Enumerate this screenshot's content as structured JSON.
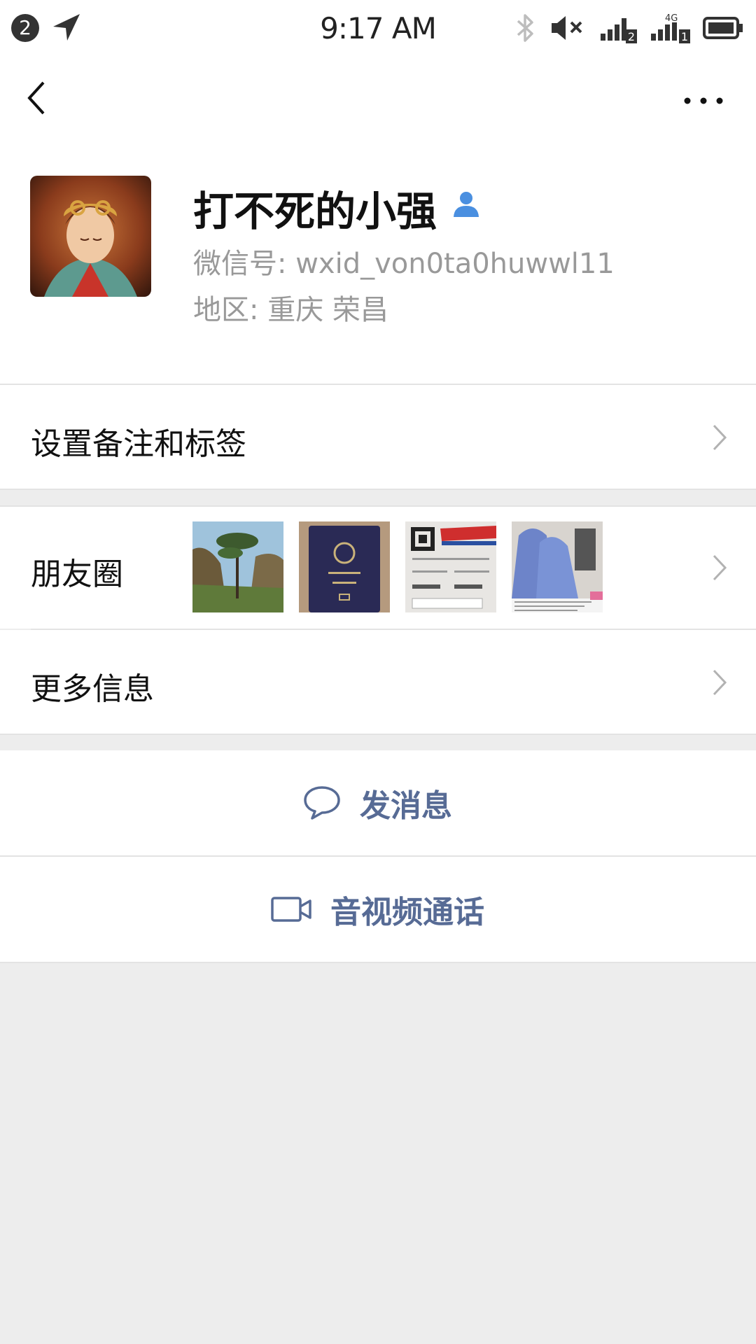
{
  "status_bar": {
    "notification_count": "2",
    "time": "9:17 AM",
    "sim1_label": "2",
    "sim2_network": "4G",
    "sim2_label": "1"
  },
  "profile": {
    "name": "打不死的小强",
    "wechat_id": "微信号:  wxid_von0ta0huwwl11",
    "region": "地区:  重庆  荣昌"
  },
  "menu": {
    "remarks_label": "设置备注和标签",
    "moments_label": "朋友圈",
    "more_info_label": "更多信息"
  },
  "actions": {
    "message_label": "发消息",
    "call_label": "音视频通话"
  },
  "colors": {
    "accent": "#576b95",
    "secondary_text": "#999999",
    "background": "#ededed"
  }
}
